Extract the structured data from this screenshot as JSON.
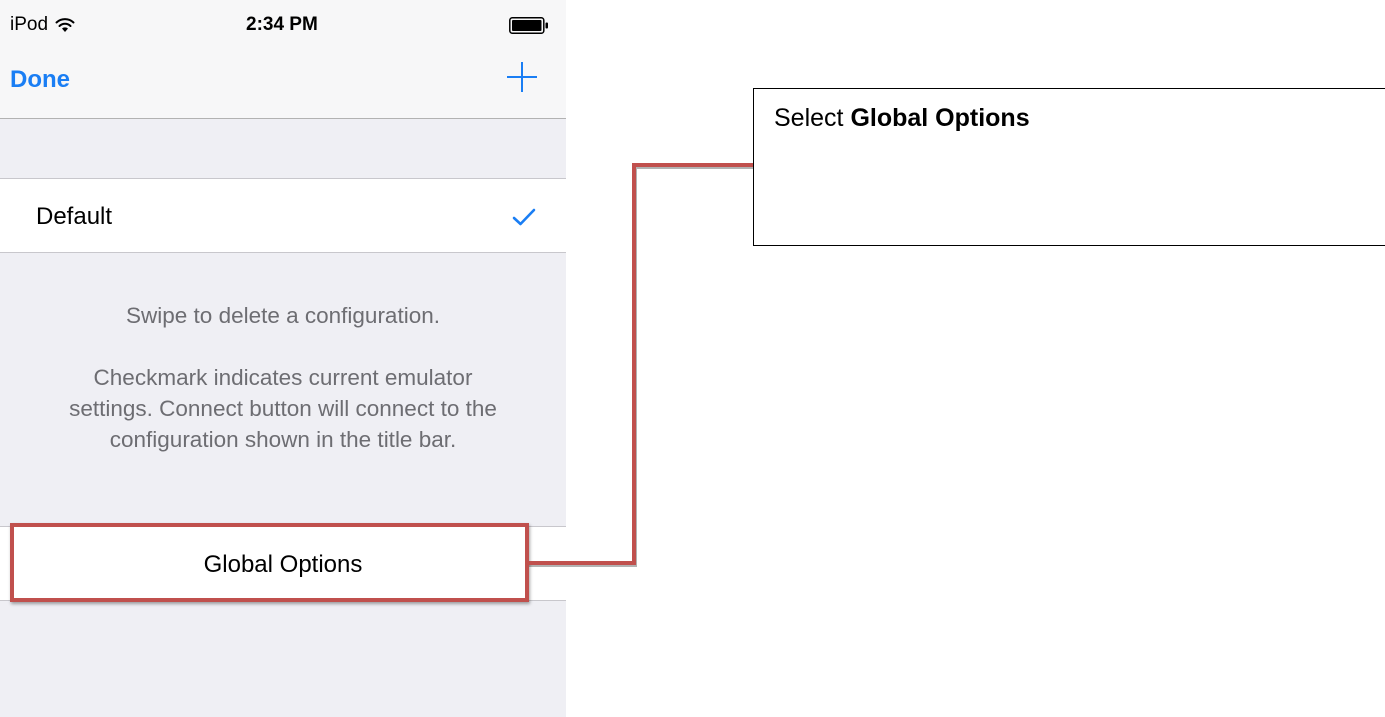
{
  "status_bar": {
    "carrier": "iPod",
    "time": "2:34 PM"
  },
  "nav_bar": {
    "done_label": "Done",
    "add_icon": "plus-icon"
  },
  "configurations": [
    {
      "name": "Default",
      "selected": true
    }
  ],
  "footer": {
    "swipe_hint": "Swipe to delete a configuration.",
    "checkmark_line1": "Checkmark indicates current emulator",
    "checkmark_line2": "settings. Connect button will connect to the",
    "checkmark_line3": "configuration shown in the title bar."
  },
  "global_options": {
    "label": "Global Options"
  },
  "callout": {
    "prefix": "Select ",
    "bold": "Global Options"
  },
  "colors": {
    "accent": "#1a7ef4",
    "highlight": "#c0504d",
    "background": "#efeff4"
  }
}
